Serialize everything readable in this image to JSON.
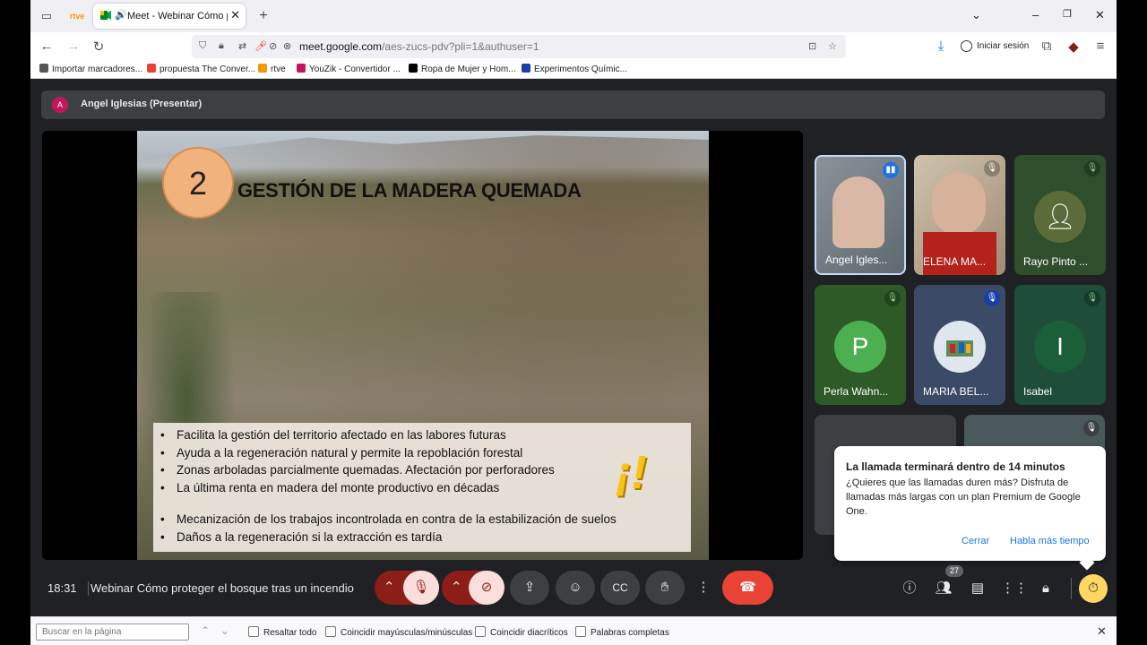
{
  "browser": {
    "tab_title": "Meet - Webinar Cómo prot",
    "url_domain": "meet.google.com",
    "url_path": "/aes-zucs-pdv?pli=1&authuser=1",
    "signin_label": "Iniciar sesión",
    "bookmarks": [
      {
        "label": "Importar marcadores...",
        "color": "#555555"
      },
      {
        "label": "propuesta The Conver...",
        "color": "#ea4335"
      },
      {
        "label": "rtve",
        "color": "#f29900"
      },
      {
        "label": "YouZik - Convertidor ...",
        "color": "#c2185b"
      },
      {
        "label": "Ropa de Mujer y Hom...",
        "color": "#000000"
      },
      {
        "label": "Experimentos Químic...",
        "color": "#1a3ea8"
      }
    ]
  },
  "meet": {
    "presenter_initial": "A",
    "presenter_label": "Angel Iglesias (Presentar)",
    "slide": {
      "number": "2",
      "title": "GESTIÓN DE LA MADERA QUEMADA",
      "bullets": [
        "Facilita la gestión del territorio afectado en las labores futuras",
        "Ayuda a la regeneración natural y permite la repoblación forestal",
        "Zonas arboladas parcialmente quemadas. Afectación por perforadores",
        "La última renta en madera del monte productivo en décadas",
        "Mecanización de los trabajos incontrolada en contra de la estabilización de suelos",
        "Daños a la regeneración si la extracción es tardía"
      ],
      "exclamation": "¡!"
    },
    "participants": [
      {
        "name": "Angel Igles...",
        "bg": "#6d7a82"
      },
      {
        "name": "ELENA MA...",
        "bg": "#8a5a4a"
      },
      {
        "name": "Rayo Pinto ...",
        "bg": "#2f4f2c"
      },
      {
        "name": "Perla Wahn...",
        "initial": "P",
        "bg": "#2d5a27",
        "circle": "#4caf50"
      },
      {
        "name": "MARIA BEL...",
        "bg": "#3b4a66"
      },
      {
        "name": "Isabel",
        "initial": "I",
        "bg": "#1e4d3a",
        "circle": "#1b5e3a"
      }
    ],
    "popup": {
      "heading": "La llamada terminará dentro de 14 minutos",
      "body": "¿Quieres que las llamadas duren más? Disfruta de llamadas más largas con un plan Premium de Google One.",
      "cancel": "Cerrar",
      "more_time": "Habla más tiempo"
    },
    "time": "18:31",
    "meeting_title": "Webinar Cómo proteger el bosque tras un incendio",
    "participant_count": "27"
  },
  "findbar": {
    "placeholder": "Buscar en la página",
    "options": [
      "Resaltar todo",
      "Coincidir mayúsculas/minúsculas",
      "Coincidir diacríticos",
      "Palabras completas"
    ]
  }
}
